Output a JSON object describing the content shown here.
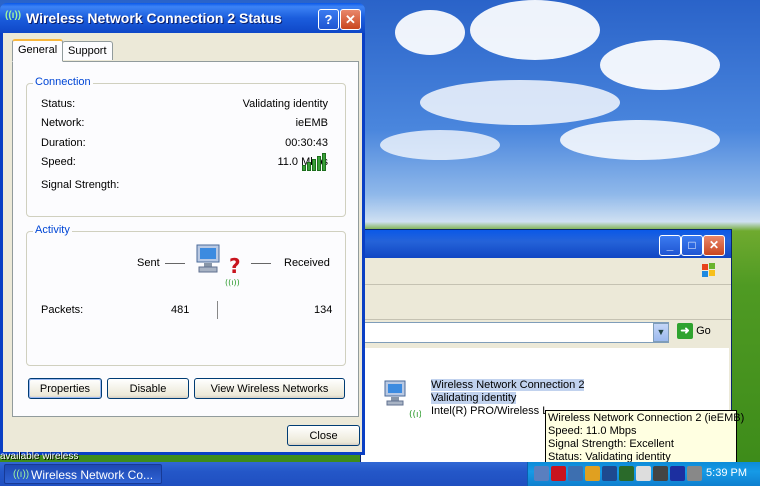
{
  "dialog": {
    "title": "Wireless Network Connection 2 Status",
    "tabs": [
      "General",
      "Support"
    ],
    "connection": {
      "legend": "Connection",
      "rows": [
        {
          "label": "Status:",
          "value": "Validating identity"
        },
        {
          "label": "Network:",
          "value": "ieEMB"
        },
        {
          "label": "Duration:",
          "value": "00:30:43"
        },
        {
          "label": "Speed:",
          "value": "11.0 Mbps"
        },
        {
          "label": "Signal Strength:",
          "value": ""
        }
      ],
      "signal_bars": 5
    },
    "activity": {
      "legend": "Activity",
      "sent_label": "Sent",
      "received_label": "Received",
      "packets_label": "Packets:",
      "packets_sent": "481",
      "packets_received": "134"
    },
    "buttons": {
      "properties": "Properties",
      "disable": "Disable",
      "view_wireless": "View Wireless Networks",
      "close": "Close"
    }
  },
  "explorer": {
    "go_label": "Go",
    "item": {
      "name": "Wireless Network Connection 2",
      "status": "Validating identity",
      "adapter": "Intel(R) PRO/Wireless L"
    }
  },
  "tooltip": {
    "line1": "Wireless Network Connection 2 (ieEMB)",
    "line2": "Speed: 11.0 Mbps",
    "line3": "Signal Strength: Excellent",
    "line4": "Status: Validating identity"
  },
  "taskbar": {
    "task_label": "Wireless Network Co...",
    "clock": "5:39 PM",
    "behind_text": "available wireless"
  },
  "colors": {
    "title_blue": "#0a58e8",
    "legend_blue": "#0046d5",
    "tray_blue": "#0c8bd8"
  }
}
